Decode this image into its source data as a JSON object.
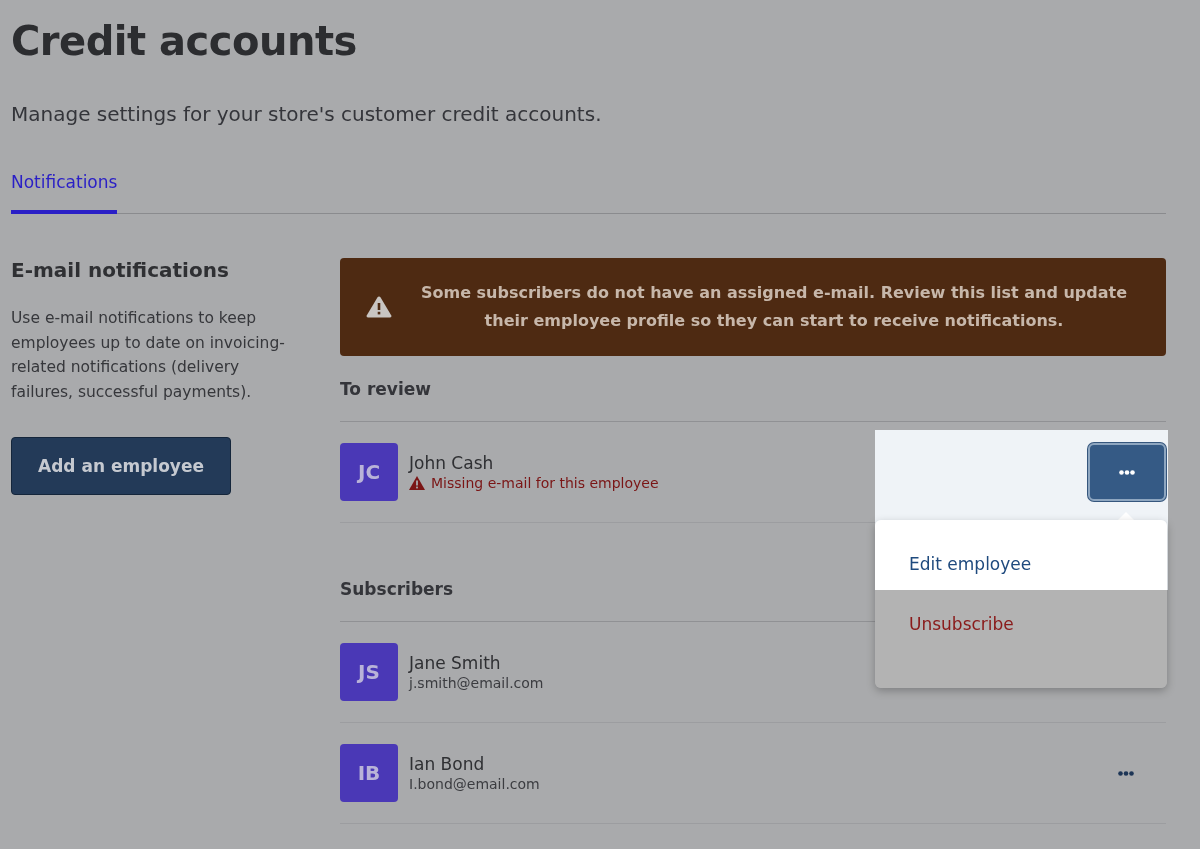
{
  "title": "Credit accounts",
  "subtitle": "Manage settings for your store's customer credit accounts.",
  "tabs": [
    {
      "label": "Notifications",
      "selected": true
    }
  ],
  "email_section": {
    "heading": "E-mail notifications",
    "description": "Use e-mail notifications to keep employees up to date on invoicing-related notifications (delivery failures, successful payments).",
    "button": "Add an employee"
  },
  "alert": {
    "message": "Some subscribers do not have an assigned e-mail. Review this list and update their employee profile so they can start to receive notifications."
  },
  "groups": [
    {
      "heading": "To review",
      "people": [
        {
          "initials": "JC",
          "name": "John Cash",
          "warning": "Missing e-mail for this employee",
          "menu_button": {
            "open": true
          }
        }
      ]
    },
    {
      "heading": "Subscribers",
      "people": [
        {
          "initials": "JS",
          "name": "Jane Smith",
          "email": "j.smith@email.com"
        },
        {
          "initials": "IB",
          "name": "Ian Bond",
          "email": "I.bond@email.com",
          "menu_button": {
            "open": false
          }
        }
      ]
    }
  ],
  "menu": {
    "items": [
      {
        "label": "Edit employee",
        "kind": "edit"
      },
      {
        "label": "Unsubscribe",
        "kind": "danger"
      }
    ]
  }
}
